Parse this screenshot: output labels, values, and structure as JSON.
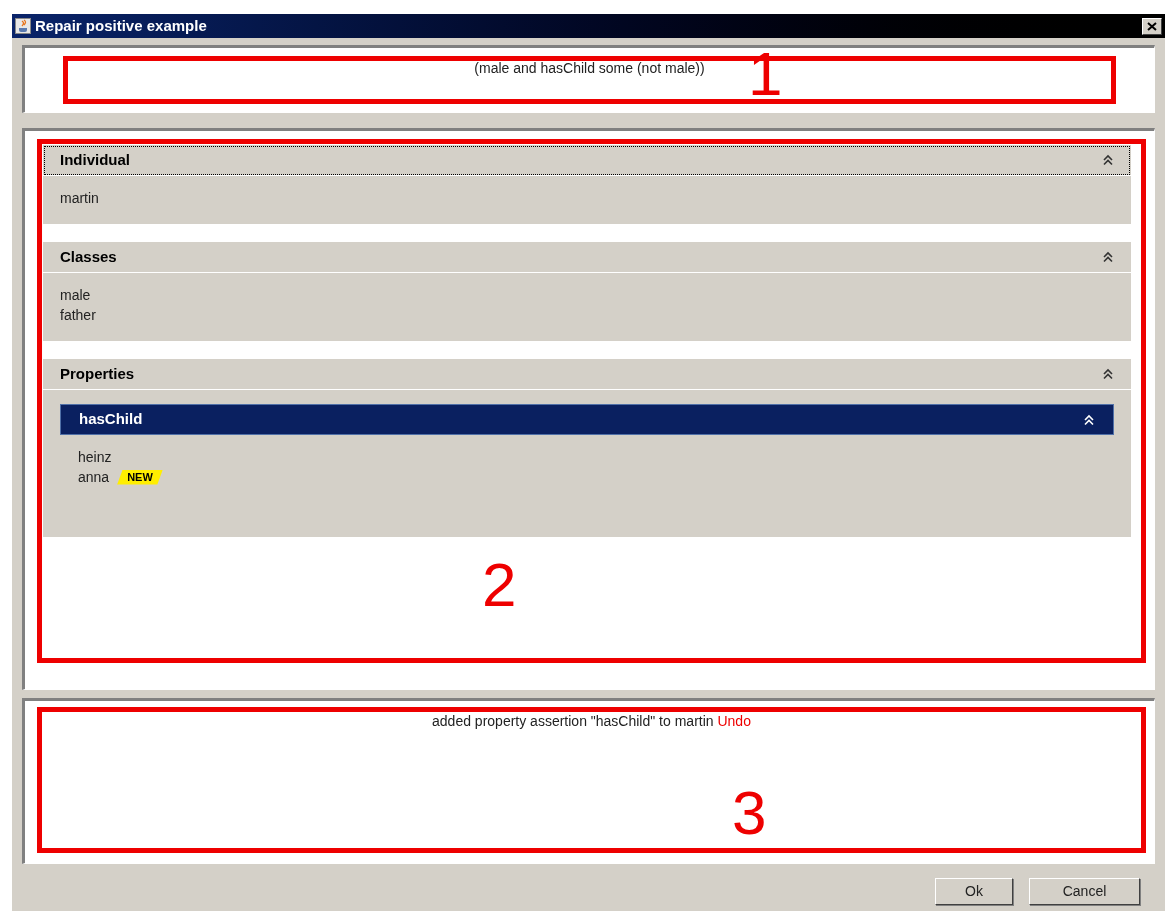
{
  "window": {
    "title": "Repair positive example"
  },
  "expression": {
    "text": "(male and hasChild some (not male))",
    "annotation": "1"
  },
  "sections": [
    {
      "title": "Individual",
      "focused": true,
      "expanded": true,
      "items": [
        {
          "label": "martin"
        }
      ]
    },
    {
      "title": "Classes",
      "focused": false,
      "expanded": true,
      "items": [
        {
          "label": "male"
        },
        {
          "label": "father"
        }
      ]
    },
    {
      "title": "Properties",
      "focused": false,
      "expanded": true,
      "properties": [
        {
          "name": "hasChild",
          "expanded": true,
          "values": [
            {
              "label": "heinz"
            },
            {
              "label": "anna",
              "badge": "NEW"
            }
          ]
        }
      ]
    }
  ],
  "details_annotation": "2",
  "log": {
    "message": "added property assertion \"hasChild\" to martin",
    "link": "Undo",
    "annotation": "3"
  },
  "buttons": [
    "Ok",
    "Cancel"
  ]
}
